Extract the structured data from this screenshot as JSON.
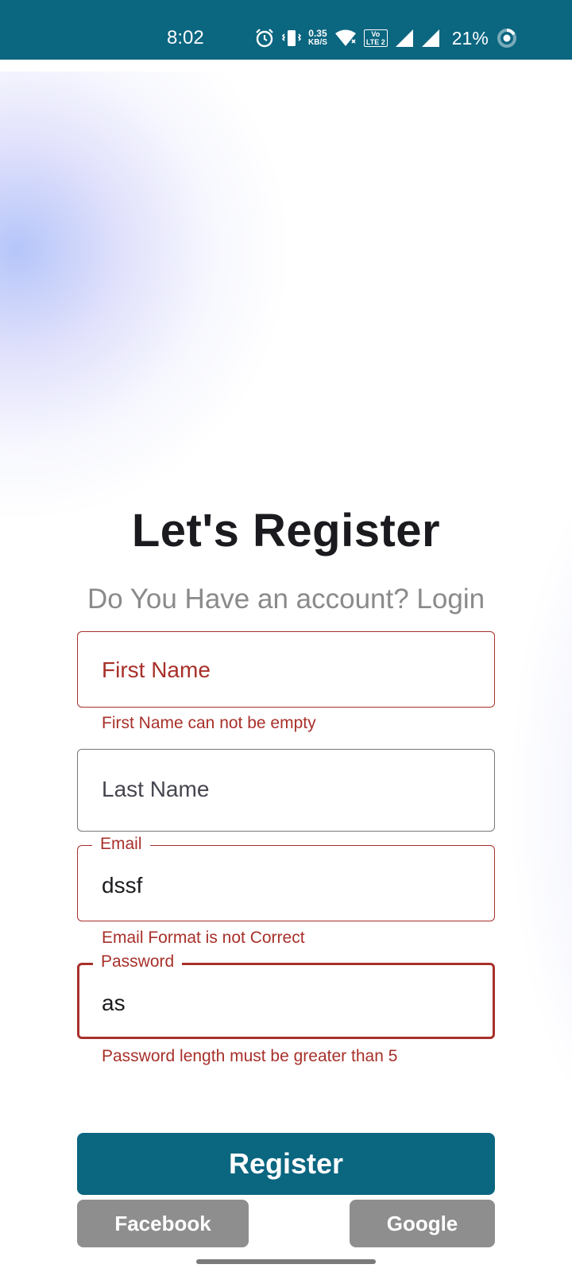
{
  "status_bar": {
    "time": "8:02",
    "net_speed_value": "0.35",
    "net_speed_unit": "KB/S",
    "volte_top": "Vo",
    "volte_bottom": "LTE 2",
    "battery": "21%",
    "icons": [
      "alarm-icon",
      "vibrate-icon",
      "wifi-icon",
      "signal-icon",
      "signal-icon",
      "battery-ring-icon"
    ]
  },
  "header": {
    "title": "Let's Register",
    "subtitle": "Do You Have an account? Login"
  },
  "form": {
    "first_name": {
      "placeholder": "First Name",
      "error": "First Name can not be empty"
    },
    "last_name": {
      "placeholder": "Last Name"
    },
    "email": {
      "label": "Email",
      "value": "dssf",
      "error": "Email Format is not Correct"
    },
    "password": {
      "label": "Password",
      "value": "as",
      "error": "Password length must be greater than 5"
    }
  },
  "actions": {
    "register": "Register",
    "facebook": "Facebook",
    "google": "Google"
  },
  "colors": {
    "primary": "#0b6680",
    "error": "#a8302a",
    "secondary_button": "#8e8e8e"
  }
}
